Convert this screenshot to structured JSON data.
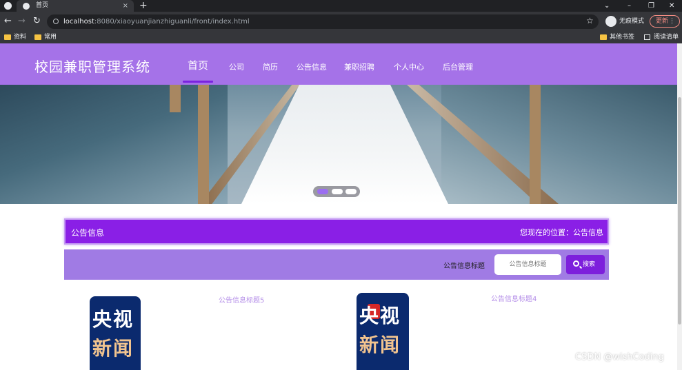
{
  "browser": {
    "tab_title": "首页",
    "tab_close": "×",
    "new_tab": "+",
    "url_host": "localhost",
    "url_rest": ":8080/xiaoyuanjianzhiguanli/front/index.html",
    "incognito_label": "无痕模式",
    "update_label": "更新",
    "bookmarks": [
      "资料",
      "常用"
    ],
    "bookmarks_right": [
      "其他书签",
      "阅读清单"
    ]
  },
  "site": {
    "title": "校园兼职管理系统",
    "nav": [
      "首页",
      "公司",
      "简历",
      "公告信息",
      "兼职招聘",
      "个人中心",
      "后台管理"
    ],
    "active_nav": "首页"
  },
  "banner": {
    "slides": 3,
    "active_slide": 1
  },
  "panel": {
    "title": "公告信息",
    "location": "您现在的位置：公告信息"
  },
  "search": {
    "label": "公告信息标题",
    "placeholder": "公告信息标题",
    "button": "搜索"
  },
  "news": [
    {
      "title": "公告信息标题5",
      "logo_line1": "央视",
      "logo_line2": "新闻"
    },
    {
      "title": "公告信息标题4",
      "logo_line1": "央视",
      "logo_line2": "新闻"
    }
  ],
  "watermark": "CSDN @wishCoding",
  "colors": {
    "header": "#a572e8",
    "panel": "#8a1fe6",
    "search_bar": "#a07be4",
    "search_button": "#7d1fdc"
  }
}
